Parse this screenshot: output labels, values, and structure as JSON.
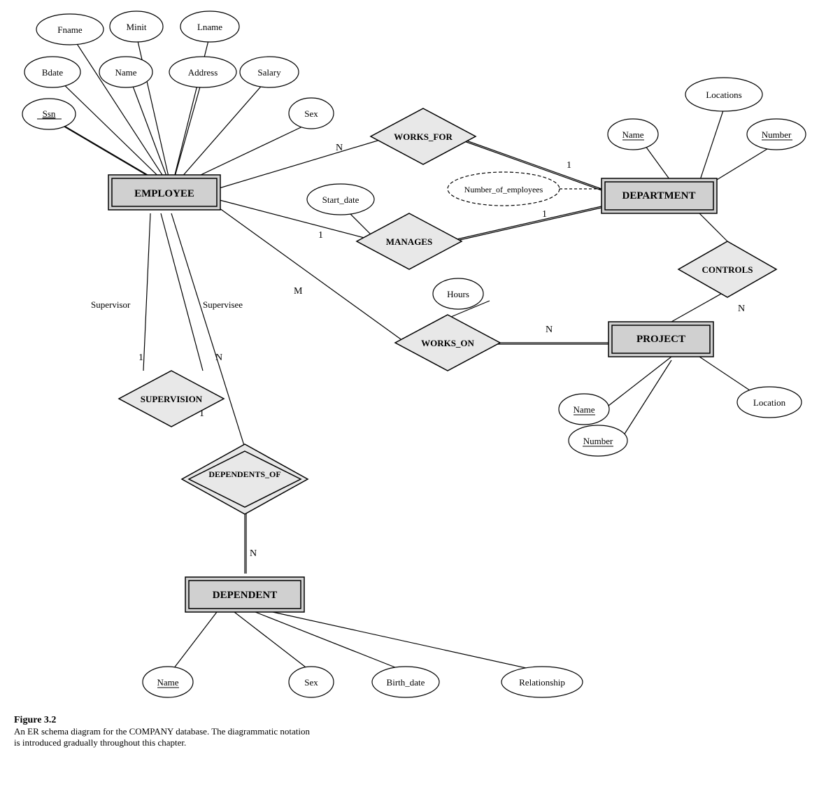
{
  "caption": {
    "title": "Figure 3.2",
    "line1": "An ER schema diagram for the COMPANY database. The diagrammatic notation",
    "line2": "is introduced gradually throughout this chapter."
  },
  "entities": {
    "employee": "EMPLOYEE",
    "department": "DEPARTMENT",
    "project": "PROJECT",
    "dependent": "DEPENDENT"
  },
  "relationships": {
    "works_for": "WORKS_FOR",
    "manages": "MANAGES",
    "controls": "CONTROLS",
    "works_on": "WORKS_ON",
    "supervision": "SUPERVISION",
    "dependents_of": "DEPENDENTS_OF"
  },
  "attributes": {
    "fname": "Fname",
    "minit": "Minit",
    "lname": "Lname",
    "bdate": "Bdate",
    "name_emp": "Name",
    "address": "Address",
    "salary": "Salary",
    "ssn": "Ssn",
    "sex_emp": "Sex",
    "start_date": "Start_date",
    "number_of_employees": "Number_of_employees",
    "locations": "Locations",
    "dept_name": "Name",
    "dept_number": "Number",
    "hours": "Hours",
    "proj_name": "Name",
    "proj_number": "Number",
    "location": "Location",
    "dep_name": "Name",
    "dep_sex": "Sex",
    "birth_date": "Birth_date",
    "relationship": "Relationship"
  },
  "cardinalities": {
    "n1": "N",
    "1a": "1",
    "1b": "1",
    "1c": "1",
    "1d": "1",
    "m": "M",
    "n2": "N",
    "n3": "N",
    "n4": "N",
    "supervisor": "Supervisor",
    "supervisee": "Supervisee"
  }
}
